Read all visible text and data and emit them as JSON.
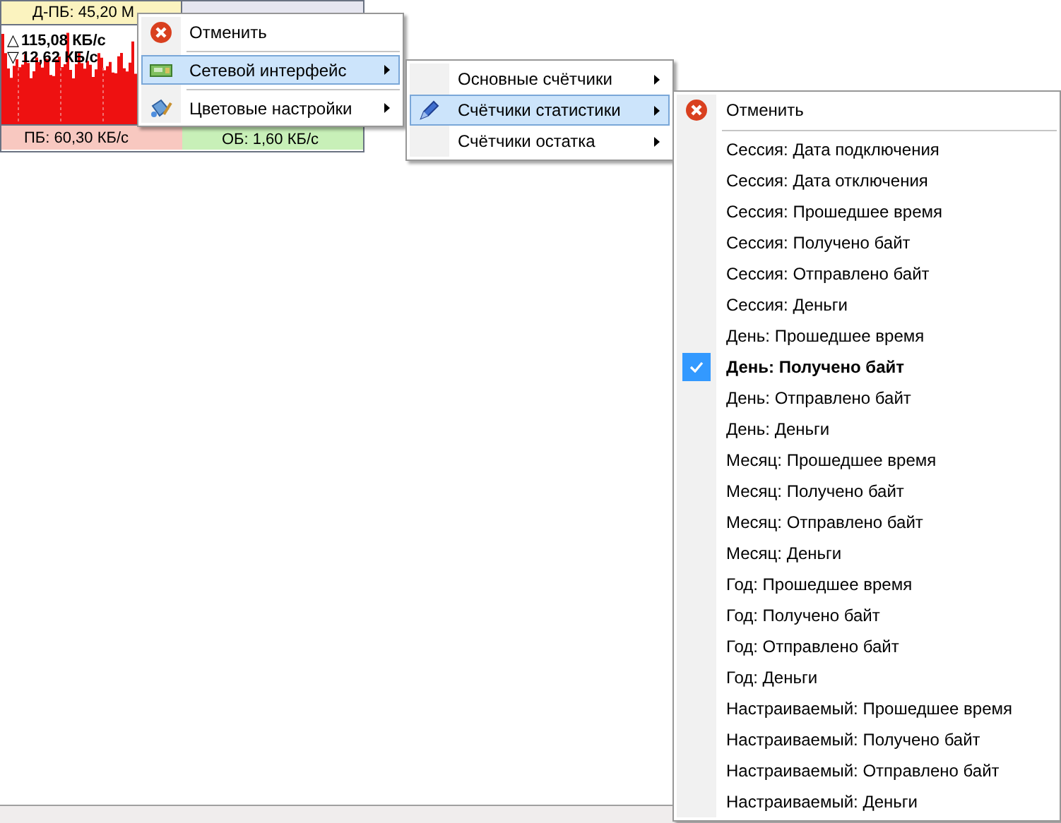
{
  "widget": {
    "top_left": "Д-ПБ: 45,20 М",
    "upload_mark": "△",
    "upload": "115,08 КБ/с",
    "download_mark": "▽",
    "download": "12,62 КБ/с",
    "bottom_left": "ПБ: 60,30 КБ/с",
    "bottom_right": "ОБ: 1,60 КБ/с"
  },
  "menus": [
    {
      "items": [
        {
          "kind": "item",
          "label": "Отменить",
          "selected": false,
          "submenu": false
        },
        {
          "kind": "separator"
        },
        {
          "kind": "item",
          "label": "Сетевой интерфейс",
          "selected": true,
          "submenu": true
        },
        {
          "kind": "separator"
        },
        {
          "kind": "item",
          "label": "Цветовые настройки",
          "selected": false,
          "submenu": true
        }
      ]
    },
    {
      "items": [
        {
          "kind": "item",
          "label": "Основные счётчики",
          "selected": false,
          "submenu": true
        },
        {
          "kind": "item",
          "label": "Счётчики статистики",
          "selected": true,
          "submenu": true
        },
        {
          "kind": "item",
          "label": "Счётчики остатка",
          "selected": false,
          "submenu": true
        }
      ]
    },
    {
      "items": [
        {
          "kind": "item",
          "label": "Отменить",
          "checked": false
        },
        {
          "kind": "separator"
        },
        {
          "kind": "item",
          "label": "Сессия: Дата подключения",
          "checked": false
        },
        {
          "kind": "item",
          "label": "Сессия: Дата отключения",
          "checked": false
        },
        {
          "kind": "item",
          "label": "Сессия: Прошедшее время",
          "checked": false
        },
        {
          "kind": "item",
          "label": "Сессия: Получено байт",
          "checked": false
        },
        {
          "kind": "item",
          "label": "Сессия: Отправлено байт",
          "checked": false
        },
        {
          "kind": "item",
          "label": "Сессия: Деньги",
          "checked": false
        },
        {
          "kind": "item",
          "label": "День: Прошедшее время",
          "checked": false
        },
        {
          "kind": "item",
          "label": "День: Получено байт",
          "checked": true
        },
        {
          "kind": "item",
          "label": "День: Отправлено байт",
          "checked": false
        },
        {
          "kind": "item",
          "label": "День: Деньги",
          "checked": false
        },
        {
          "kind": "item",
          "label": "Месяц: Прошедшее время",
          "checked": false
        },
        {
          "kind": "item",
          "label": "Месяц: Получено байт",
          "checked": false
        },
        {
          "kind": "item",
          "label": "Месяц: Отправлено байт",
          "checked": false
        },
        {
          "kind": "item",
          "label": "Месяц: Деньги",
          "checked": false
        },
        {
          "kind": "item",
          "label": "Год: Прошедшее время",
          "checked": false
        },
        {
          "kind": "item",
          "label": "Год: Получено байт",
          "checked": false
        },
        {
          "kind": "item",
          "label": "Год: Отправлено байт",
          "checked": false
        },
        {
          "kind": "item",
          "label": "Год: Деньги",
          "checked": false
        },
        {
          "kind": "item",
          "label": "Настраиваемый: Прошедшее время",
          "checked": false
        },
        {
          "kind": "item",
          "label": "Настраиваемый: Получено байт",
          "checked": false
        },
        {
          "kind": "item",
          "label": "Настраиваемый: Отправлено байт",
          "checked": false
        },
        {
          "kind": "item",
          "label": "Настраиваемый: Деньги",
          "checked": false
        }
      ]
    }
  ]
}
